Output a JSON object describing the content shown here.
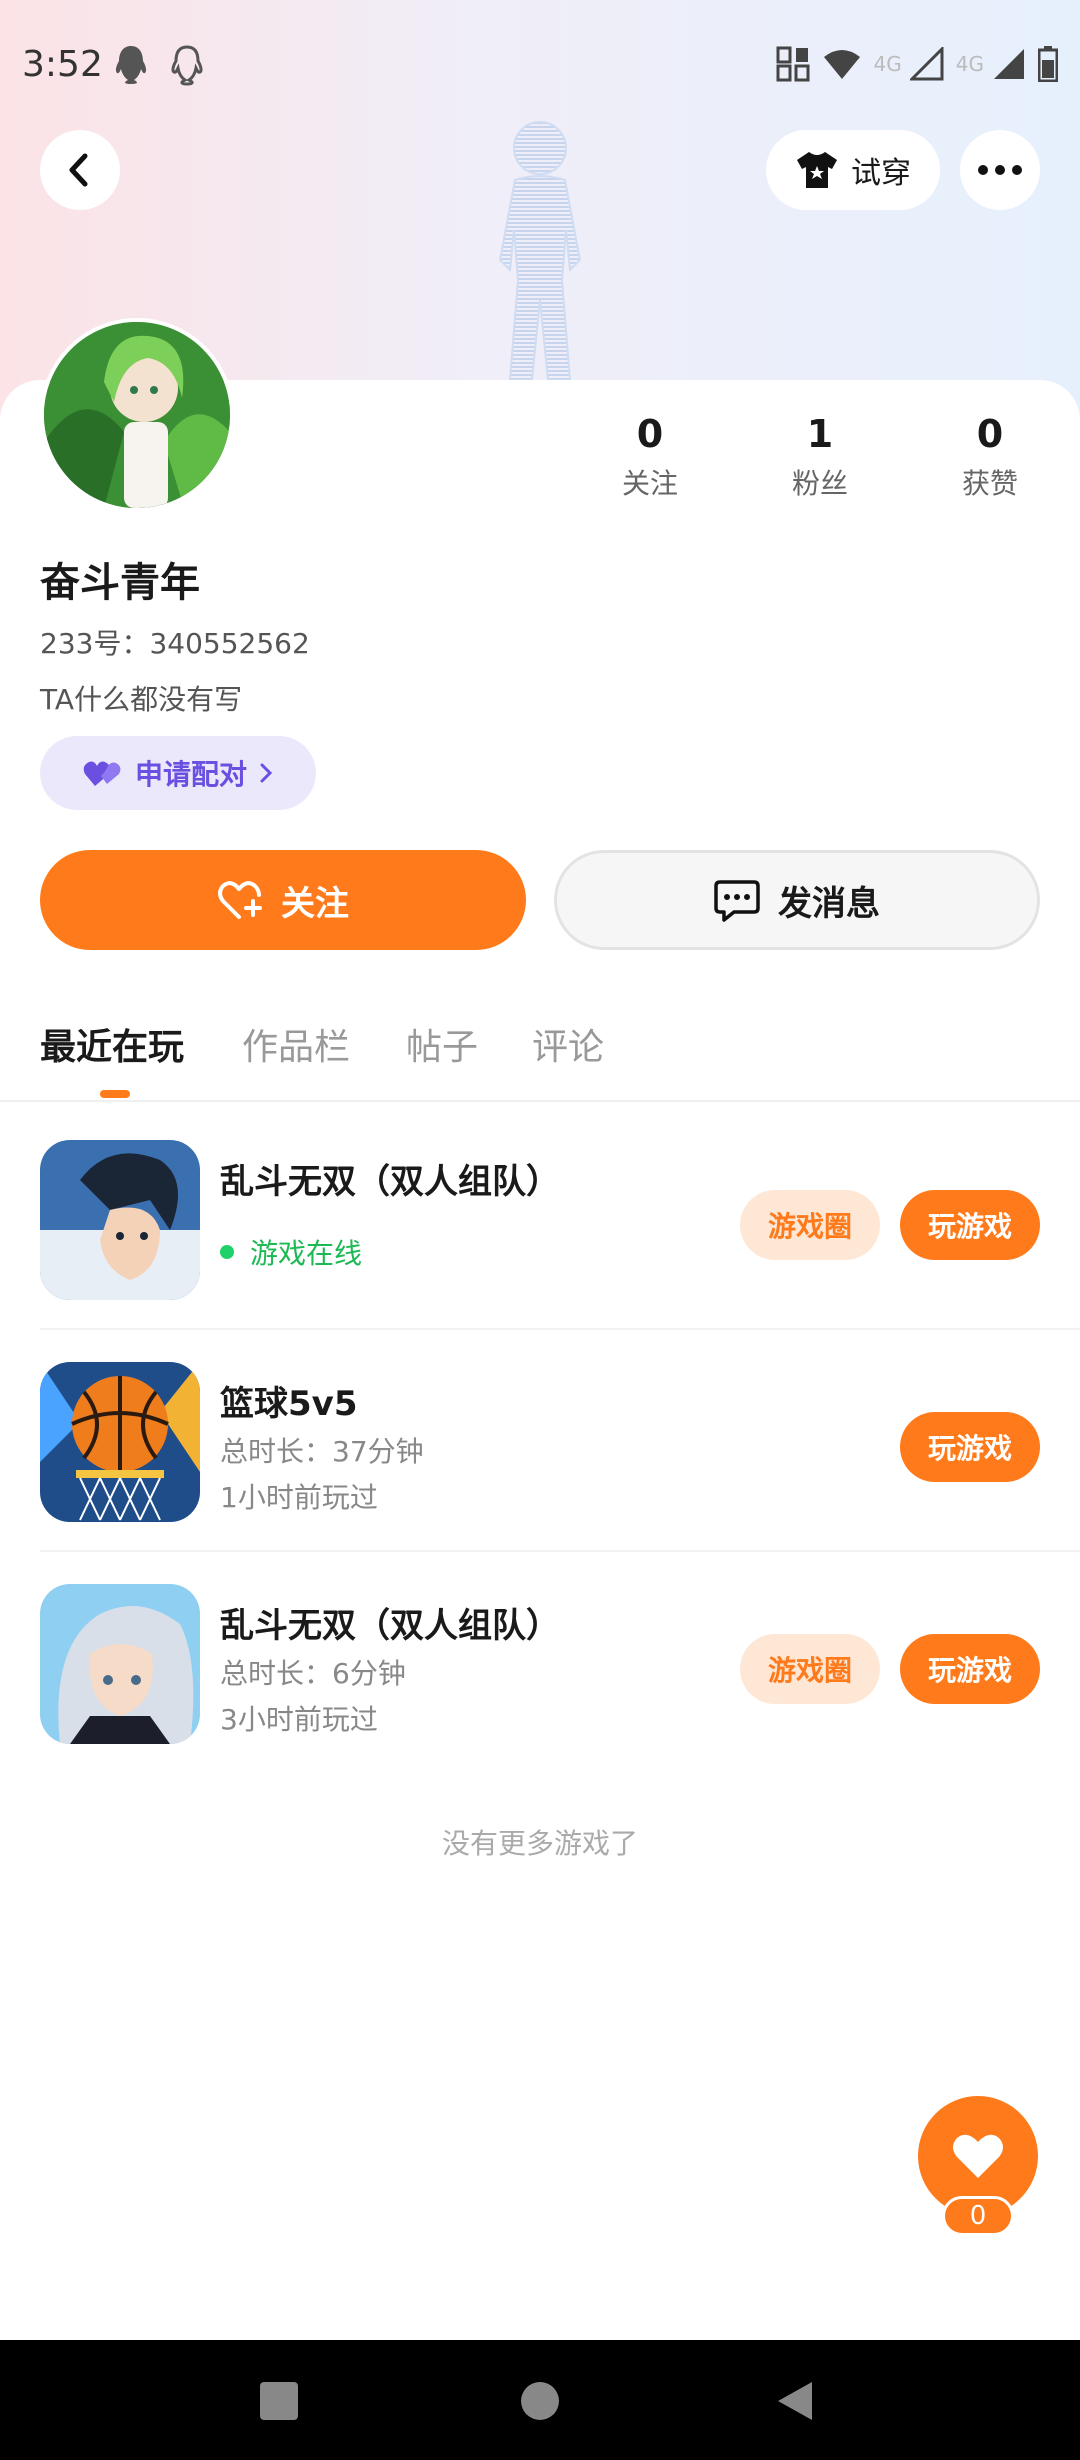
{
  "status_bar": {
    "time": "3:52",
    "icons": [
      "qq-icon",
      "qq-outline-icon",
      "data-saver-icon",
      "wifi-icon",
      "signal-4g-icon",
      "signal-4g-icon",
      "battery-icon"
    ],
    "net1": "4G",
    "net2": "4G"
  },
  "header": {
    "back_icon": "chevron-left-icon",
    "tryon_label": "试穿",
    "tryon_icon": "shirt-icon",
    "more_icon": "more-dots-icon"
  },
  "profile": {
    "nickname": "奋斗青年",
    "uid": "233号：340552562",
    "bio": "TA什么都没有写",
    "pair_label": "申请配对",
    "stats": [
      {
        "num": "0",
        "label": "关注"
      },
      {
        "num": "1",
        "label": "粉丝"
      },
      {
        "num": "0",
        "label": "获赞"
      }
    ]
  },
  "actions": {
    "follow_label": "关注",
    "message_label": "发消息"
  },
  "tabs": [
    "最近在玩",
    "作品栏",
    "帖子",
    "评论"
  ],
  "games": [
    {
      "title": "乱斗无双（双人组队）",
      "status": "游戏在线",
      "circle_label": "游戏圈",
      "play_label": "玩游戏"
    },
    {
      "title": "篮球5v5",
      "duration": "总时长：37分钟",
      "last_played": "1小时前玩过",
      "play_label": "玩游戏"
    },
    {
      "title": "乱斗无双（双人组队）",
      "duration": "总时长：6分钟",
      "last_played": "3小时前玩过",
      "circle_label": "游戏圈",
      "play_label": "玩游戏"
    }
  ],
  "no_more_text": "没有更多游戏了",
  "like": {
    "count": "0"
  },
  "colors": {
    "accent": "#ff7a1a",
    "accent_light": "#ffe7d6",
    "pair_purple": "#6b4fe0",
    "online_green": "#1db954"
  }
}
